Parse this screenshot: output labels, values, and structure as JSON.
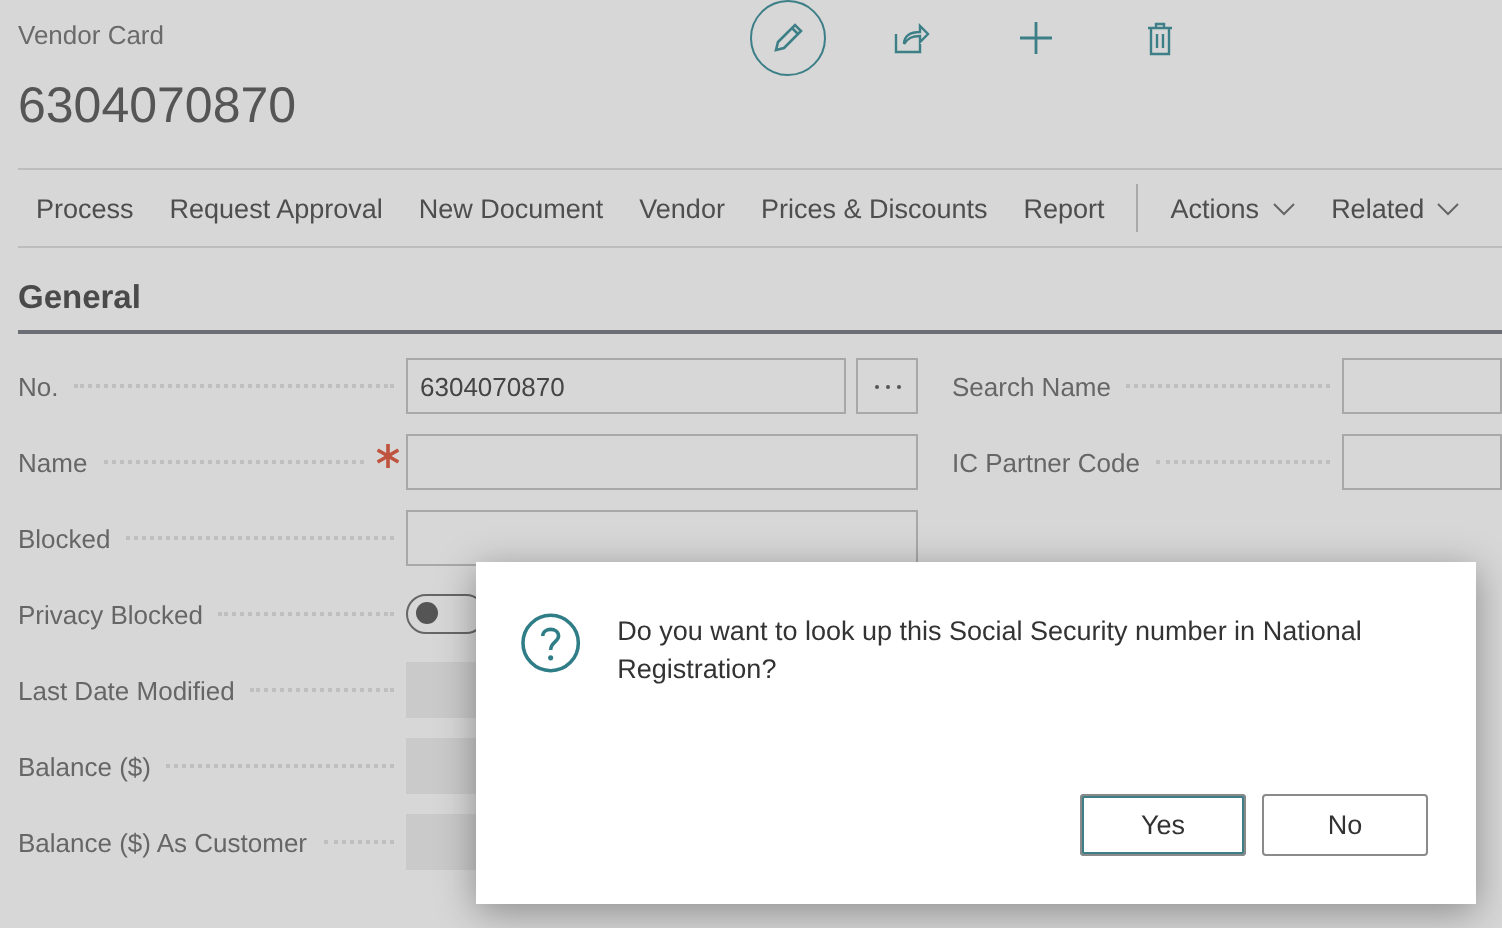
{
  "header": {
    "caption": "Vendor Card",
    "title": "6304070870"
  },
  "actions": [
    {
      "label": "Process",
      "kind": "action"
    },
    {
      "label": "Request Approval",
      "kind": "action"
    },
    {
      "label": "New Document",
      "kind": "action"
    },
    {
      "label": "Vendor",
      "kind": "action"
    },
    {
      "label": "Prices & Discounts",
      "kind": "action"
    },
    {
      "label": "Report",
      "kind": "action"
    },
    {
      "label": "Actions",
      "kind": "menu"
    },
    {
      "label": "Related",
      "kind": "menu"
    }
  ],
  "section": {
    "title": "General"
  },
  "fields": [
    {
      "label": "No.",
      "kind": "text",
      "value": "6304070870",
      "assist": true,
      "required": false
    },
    {
      "label": "Name",
      "kind": "text",
      "required": true,
      "assist": false
    },
    {
      "label": "Blocked",
      "kind": "text",
      "required": false,
      "assist": false
    },
    {
      "label": "Privacy Blocked",
      "kind": "toggle",
      "on": false
    },
    {
      "label": "Last Date Modified",
      "kind": "readonly"
    },
    {
      "label": "Balance ($)",
      "kind": "readonly"
    },
    {
      "label": "Balance ($) As Customer",
      "kind": "readonly"
    }
  ],
  "right_fields": [
    {
      "label": "Search Name",
      "kind": "text"
    },
    {
      "label": "IC Partner Code",
      "kind": "text"
    }
  ],
  "dialog": {
    "message": "Do you want to look up this Social Security number in National Registration?",
    "buttons": [
      {
        "label": "Yes",
        "focused": true
      },
      {
        "label": "No",
        "focused": false
      }
    ]
  }
}
